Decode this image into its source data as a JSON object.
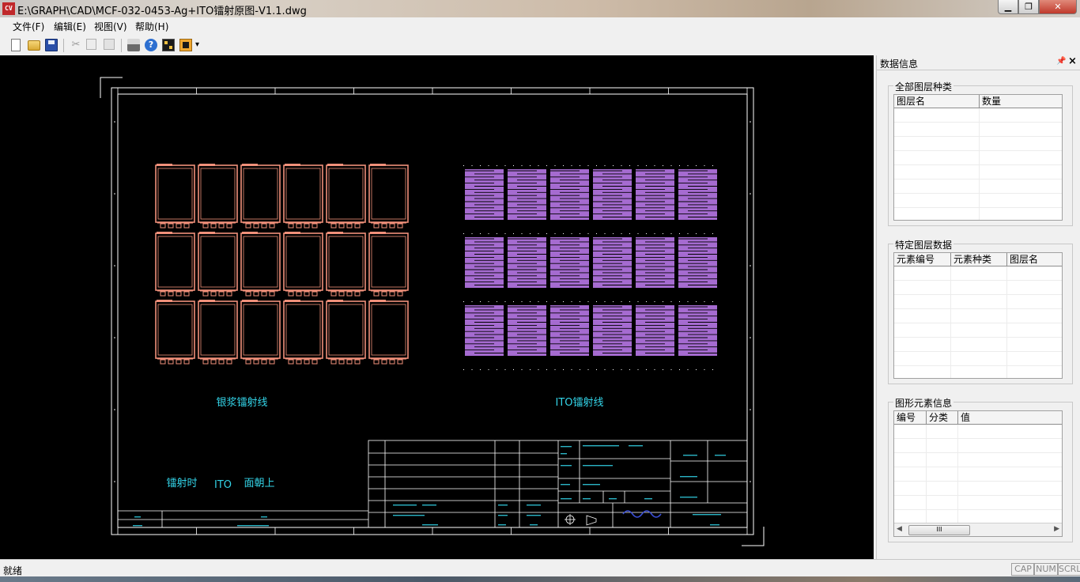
{
  "window": {
    "title": "E:\\GRAPH\\CAD\\MCF-032-0453-Ag+ITO镭射原图-V1.1.dwg",
    "icon": "app-logo-icon",
    "minimize_glyph": "▁",
    "maximize_glyph": "❐",
    "close_glyph": "✕"
  },
  "menu": [
    {
      "label": "文件(F)"
    },
    {
      "label": "编辑(E)"
    },
    {
      "label": "视图(V)"
    },
    {
      "label": "帮助(H)"
    }
  ],
  "toolbar": {
    "icons": [
      "new-file-icon",
      "open-folder-icon",
      "save-icon",
      "cut-icon",
      "copy-icon",
      "paste-icon",
      "print-icon",
      "help-icon",
      "layers-icon",
      "layout-icon",
      "dropdown-arrow-icon"
    ],
    "dropdown_glyph": "▾"
  },
  "drawing": {
    "left_label": "银浆镭射线",
    "right_label": "ITO镭射线",
    "note_1": "镭射时",
    "note_2": "ITO",
    "note_3": "面朝上",
    "colors": {
      "silver": "#f0907a",
      "ito": "#c27ef5",
      "frame": "#ffffff",
      "text": "#33d4e8",
      "background": "#000000"
    },
    "grid": {
      "rows": 3,
      "cols": 6
    }
  },
  "panel": {
    "title": "数据信息",
    "pin_glyph": "📌",
    "close_glyph": "×",
    "groups": [
      {
        "title": "全部图层种类",
        "columns": [
          "图层名",
          "数量"
        ]
      },
      {
        "title": "特定图层数据",
        "columns": [
          "元素编号",
          "元素种类",
          "图层名"
        ]
      },
      {
        "title": "图形元素信息",
        "columns": [
          "编号",
          "分类",
          "值"
        ]
      }
    ],
    "scroll_left": "◀",
    "scroll_right": "▶",
    "scroll_thumb": "III"
  },
  "status": {
    "text": "就绪",
    "indicators": [
      "CAP",
      "NUM",
      "SCRL"
    ]
  }
}
